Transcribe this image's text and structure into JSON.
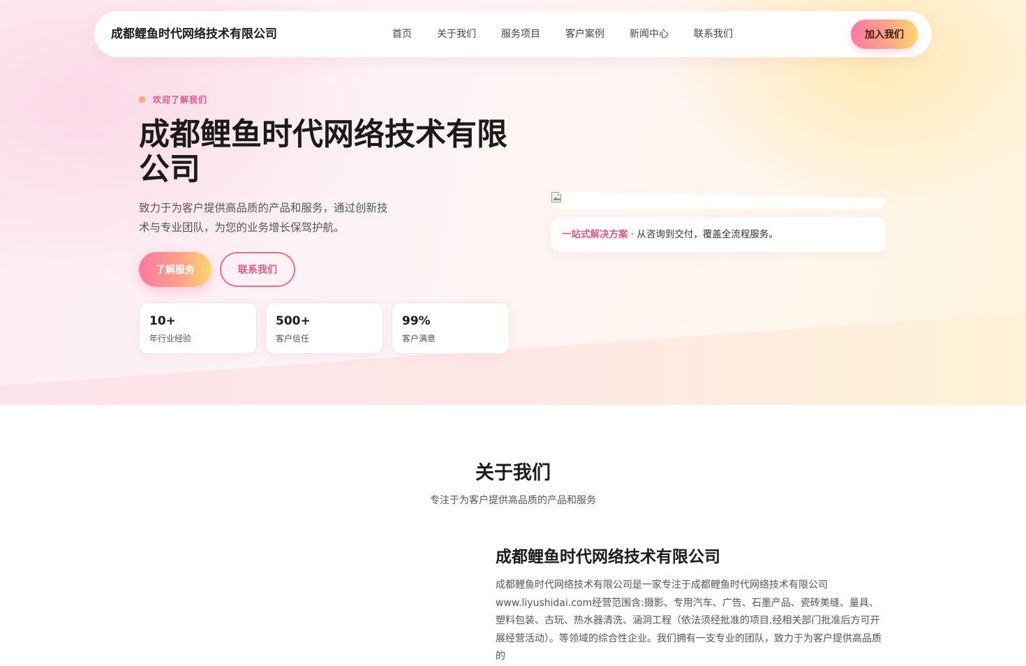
{
  "nav": {
    "brand": "成都鲤鱼时代网络技术有限公司",
    "links": [
      "首页",
      "关于我们",
      "服务项目",
      "客户案例",
      "新闻中心",
      "联系我们"
    ],
    "cta": "加入我们"
  },
  "hero": {
    "eyebrow": "欢迎了解我们",
    "title": "成都鲤鱼时代网络技术有限公司",
    "description": "致力于为客户提供高品质的产品和服务，通过创新技术与专业团队，为您的业务增长保驾护航。",
    "primary_button": "了解服务",
    "secondary_button": "联系我们",
    "stats": [
      {
        "value": "10+",
        "label": "年行业经验"
      },
      {
        "value": "500+",
        "label": "客户信任"
      },
      {
        "value": "99%",
        "label": "客户满意"
      }
    ],
    "note_highlight": "一站式解决方案",
    "note_text": " · 从咨询到交付，覆盖全流程服务。"
  },
  "about": {
    "section_title": "关于我们",
    "section_subtitle": "专注于为客户提供高品质的产品和服务",
    "title": "成都鲤鱼时代网络技术有限公司",
    "body": "成都鲤鱼时代网络技术有限公司是一家专注于成都鲤鱼时代网络技术有限公司www.liyushidai.com经营范围含:摄影、专用汽车、广告、石墨产品、瓷砖美缝、量具、塑料包装、古玩、热水器清洗、涵洞工程（依法须经批准的项目,经相关部门批准后方可开展经营活动）。等领域的综合性企业。我们拥有一支专业的团队，致力于为客户提供高品质的"
  },
  "colors": {
    "accent_pink": "#e0588a",
    "gradient_start": "#fb7aa0",
    "gradient_end": "#ffd66b"
  }
}
